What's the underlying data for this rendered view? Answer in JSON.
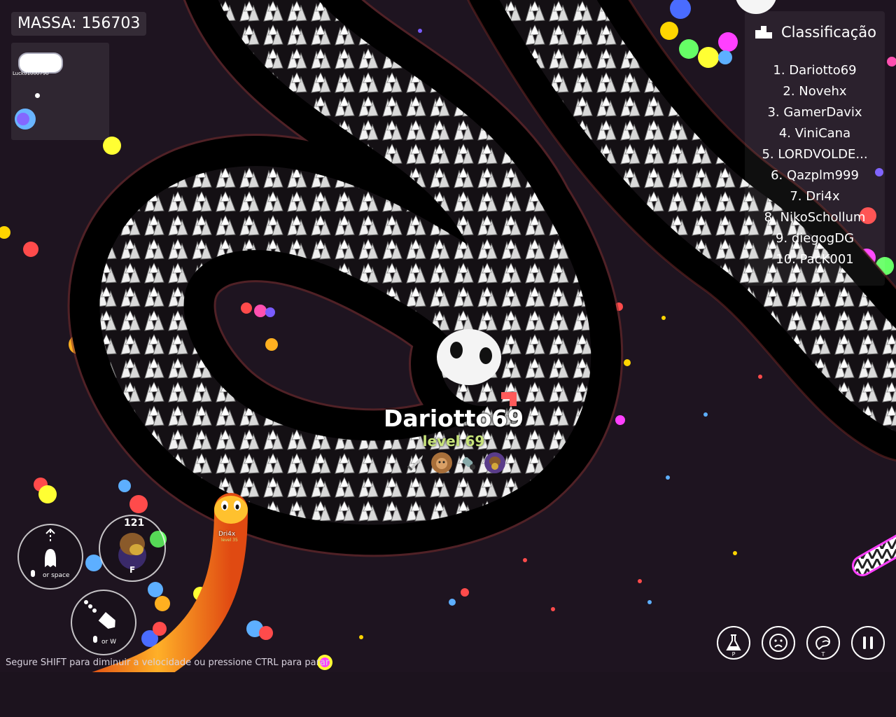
{
  "hud": {
    "mass_label": "MASSA: 156703",
    "minimap_player": "Luck0100079​0"
  },
  "leaderboard": {
    "title": "Classificação",
    "rows": [
      "1. Dariotto69",
      "2. Novehx",
      "3. GamerDavix",
      "4. ViniCana",
      "5. LORDVOLDE...",
      "6. Qazplm999",
      "7. Dri4x",
      "8. NikoSchollum",
      "9. diegogDG",
      "10. PacK001"
    ]
  },
  "player": {
    "name": "Dariotto69",
    "level": "level 69"
  },
  "other_snake": {
    "name": "Dri4x",
    "level": "level 35"
  },
  "abilities": {
    "boost_caption": "or space",
    "drop_caption": "or W",
    "item_count": "121",
    "item_key": "F"
  },
  "hint": "Segure SHIFT para diminuir a velocidade ou pressione CTRL para parar.",
  "buttons": {
    "potion_key": "P",
    "emote_key": "",
    "chat_key": "T"
  },
  "colors": {
    "background": "#1e1420",
    "snake_body": "#ffffff",
    "level_text": "#c7e37a",
    "dri_snake": "#f2a522"
  }
}
